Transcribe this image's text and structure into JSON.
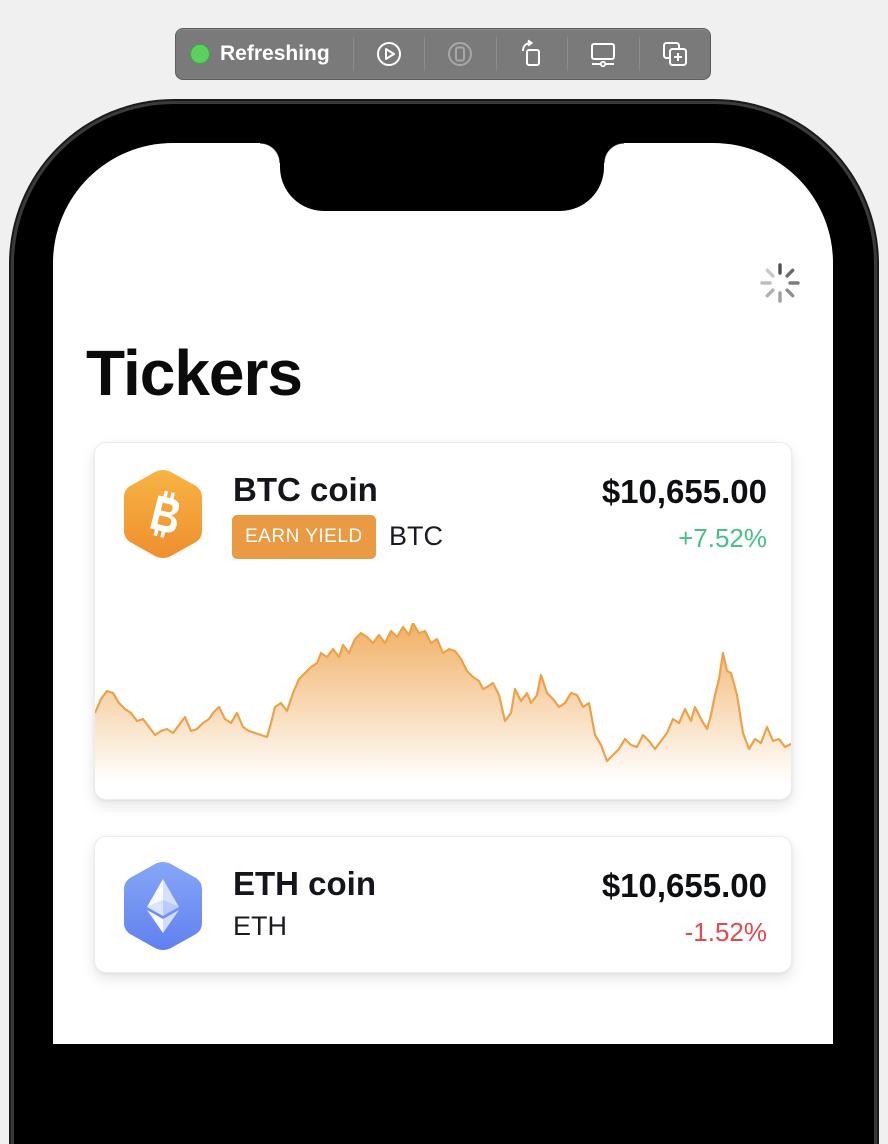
{
  "toolbar": {
    "status": "Refreshing",
    "status_color": "#5dd160",
    "buttons": [
      {
        "icon": "play-circle-icon"
      },
      {
        "icon": "device-icon"
      },
      {
        "icon": "rotate-icon"
      },
      {
        "icon": "display-icon"
      },
      {
        "icon": "duplicate-icon"
      }
    ]
  },
  "page": {
    "title": "Tickers",
    "loading_icon": "activity-spinner-icon"
  },
  "tickers": [
    {
      "name": "BTC coin",
      "symbol": "BTC",
      "badge": "EARN YIELD",
      "price": "$10,655.00",
      "change": "+7.52%",
      "change_direction": "up",
      "logo_icon": "bitcoin-icon",
      "accent": "#f1a53b"
    },
    {
      "name": "ETH coin",
      "symbol": "ETH",
      "price": "$10,655.00",
      "change": "-1.52%",
      "change_direction": "down",
      "logo_icon": "ethereum-icon",
      "accent": "#6f8ff3"
    }
  ],
  "colors": {
    "up": "#48c08c",
    "down": "#e8474b",
    "badge_bg": "#e99a43",
    "sparkline": "#eaa24b"
  }
}
